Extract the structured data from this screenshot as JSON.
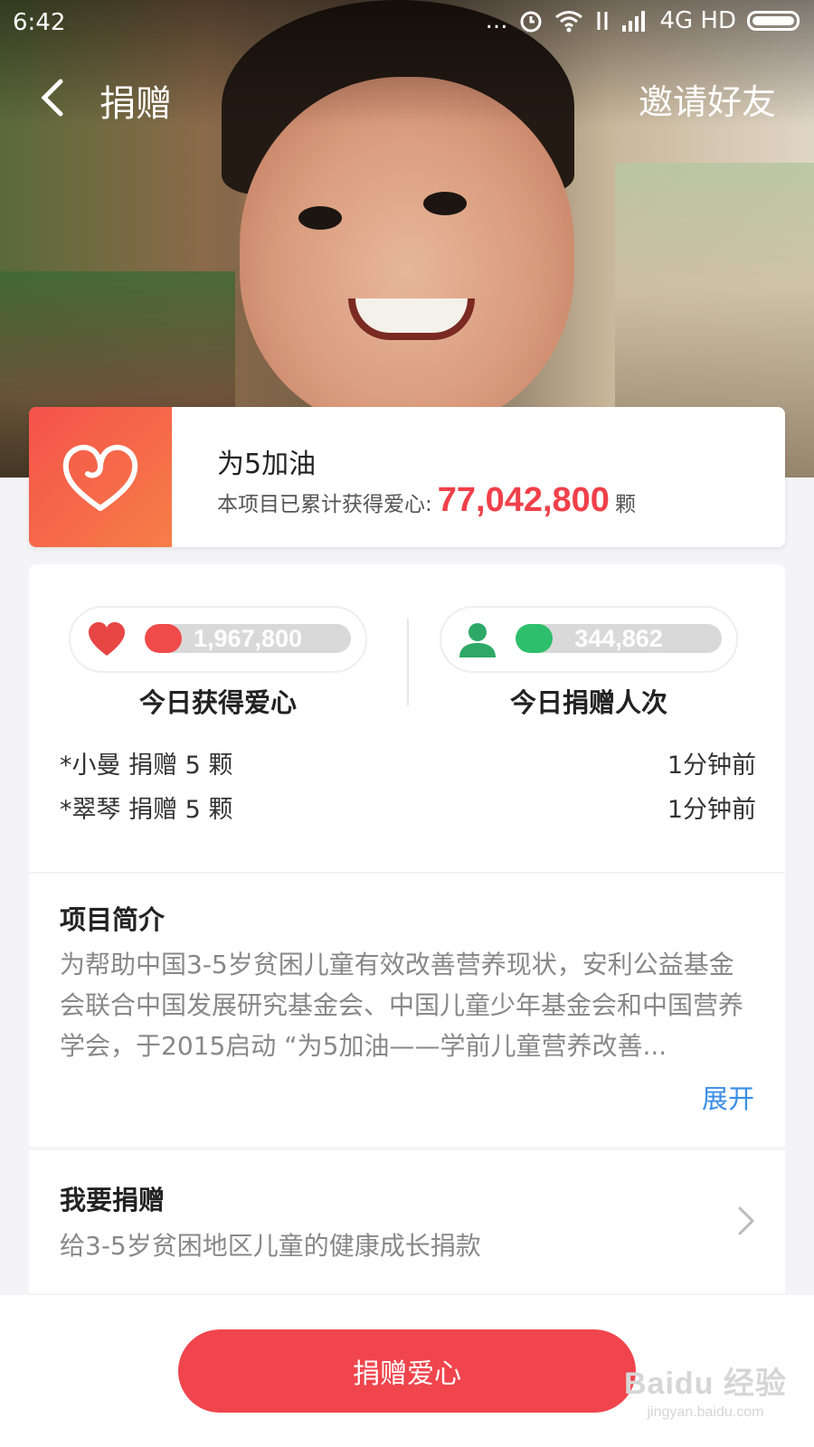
{
  "status_bar": {
    "time": "6:42",
    "dots": "...",
    "network": "4G HD"
  },
  "nav": {
    "title": "捐赠",
    "invite": "邀请好友"
  },
  "project": {
    "name": "为5加油",
    "stat_prefix": "本项目已累计获得爱心:",
    "total_hearts": "77,042,800",
    "unit": "颗"
  },
  "today": {
    "hearts": {
      "value": "1,967,800",
      "label": "今日获得爱心",
      "fill_fraction": 0.18,
      "color": "#f04a4a"
    },
    "donors": {
      "value": "344,862",
      "label": "今日捐赠人次",
      "fill_fraction": 0.18,
      "color": "#2ebf6c"
    },
    "recent": [
      {
        "who": "*小曼 捐赠 5 颗",
        "when": "1分钟前"
      },
      {
        "who": "*翠琴 捐赠 5 颗",
        "when": "1分钟前"
      }
    ]
  },
  "intro": {
    "heading": "项目简介",
    "body": "为帮助中国3-5岁贫困儿童有效改善营养现状，安利公益基金会联合中国发展研究基金会、中国儿童少年基金会和中国营养学会，于2015启动 “为5加油——学前儿童营养改善...",
    "expand": "展开"
  },
  "donate": {
    "heading": "我要捐赠",
    "sub": "给3-5岁贫困地区儿童的健康成长捐款"
  },
  "bottom": {
    "button": "捐赠爱心"
  },
  "watermark": {
    "main": "Baidu 经验",
    "url": "jingyan.baidu.com"
  },
  "colors": {
    "accent": "#f0454d",
    "link": "#3a8ee6"
  }
}
